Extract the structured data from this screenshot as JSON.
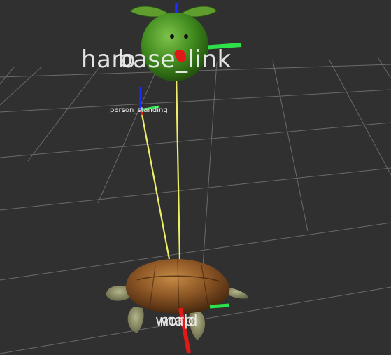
{
  "viewer": {
    "background_color": "#303030",
    "grid_color": "#a8a8a8",
    "link_color": "#f0f060"
  },
  "frames": {
    "head_label_a": "haro",
    "head_label_b": "base_link",
    "person_label": "person_standing",
    "bottom_label_a": "world",
    "bottom_label_b": "map"
  },
  "models": {
    "upper": "haro-robot-head",
    "lower": "turtle"
  }
}
